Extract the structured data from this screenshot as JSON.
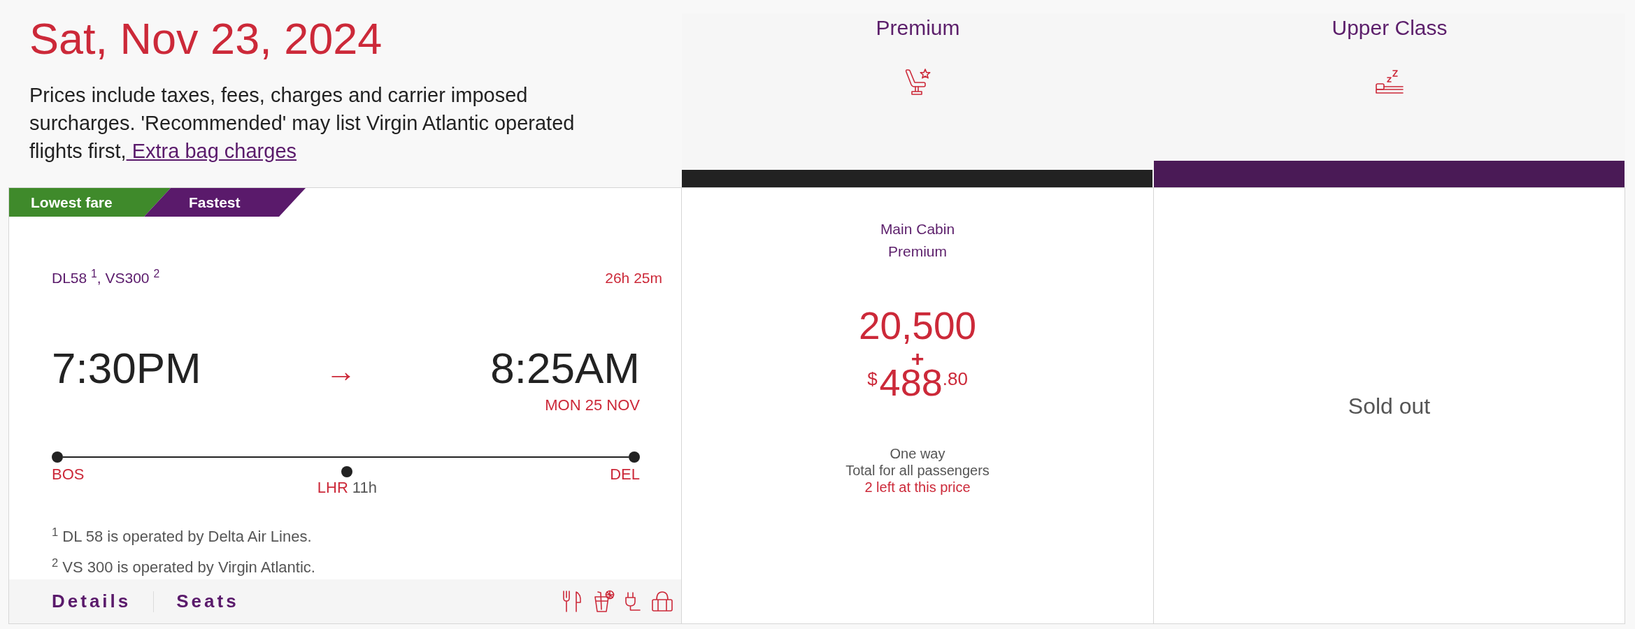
{
  "header": {
    "date": "Sat, Nov 23, 2024",
    "notice": "Prices include taxes, fees, charges and carrier imposed surcharges. 'Recommended' may list Virgin Atlantic operated flights first,",
    "notice_link": " Extra bag charges"
  },
  "cabin_columns": [
    {
      "kind": "premium",
      "title": "Premium",
      "color": "#222222",
      "fare": {
        "kind": "available",
        "cabin": "Main Cabin",
        "fare_name": "Premium",
        "points": "20,500",
        "plus": "+",
        "currency": "$",
        "amount": "488",
        "cents": ".80",
        "trip": "One way",
        "total_note": "Total for all passengers",
        "availability": "2 left at this price"
      }
    },
    {
      "kind": "upper_class",
      "title": "Upper Class",
      "color": "#4a1a56",
      "fare": {
        "kind": "sold_out",
        "label": "Sold out"
      }
    }
  ],
  "flight": {
    "badges": [
      {
        "label": "Lowest fare",
        "color": "#3f8a2b"
      },
      {
        "label": "Fastest",
        "color": "#5a1a6b"
      }
    ],
    "flight_numbers": "DL58 $^{1}$, VS300 $^{2}$",
    "duration": "26h 25m",
    "depart_time": "7:30PM",
    "arrow": "→",
    "arrive_time": "8:25AM",
    "arrive_date": "MON 25 NOV",
    "route": {
      "origin": "BOS",
      "stop": {
        "code": "LHR",
        "layover": "11h"
      },
      "destination": "DEL"
    },
    "footnotes": [
      "$^{1}$ DL 58 is operated by Delta Air Lines.",
      "$^{2}$ VS 300 is operated by Virgin Atlantic."
    ],
    "links": [
      "Details",
      "Seats"
    ]
  }
}
